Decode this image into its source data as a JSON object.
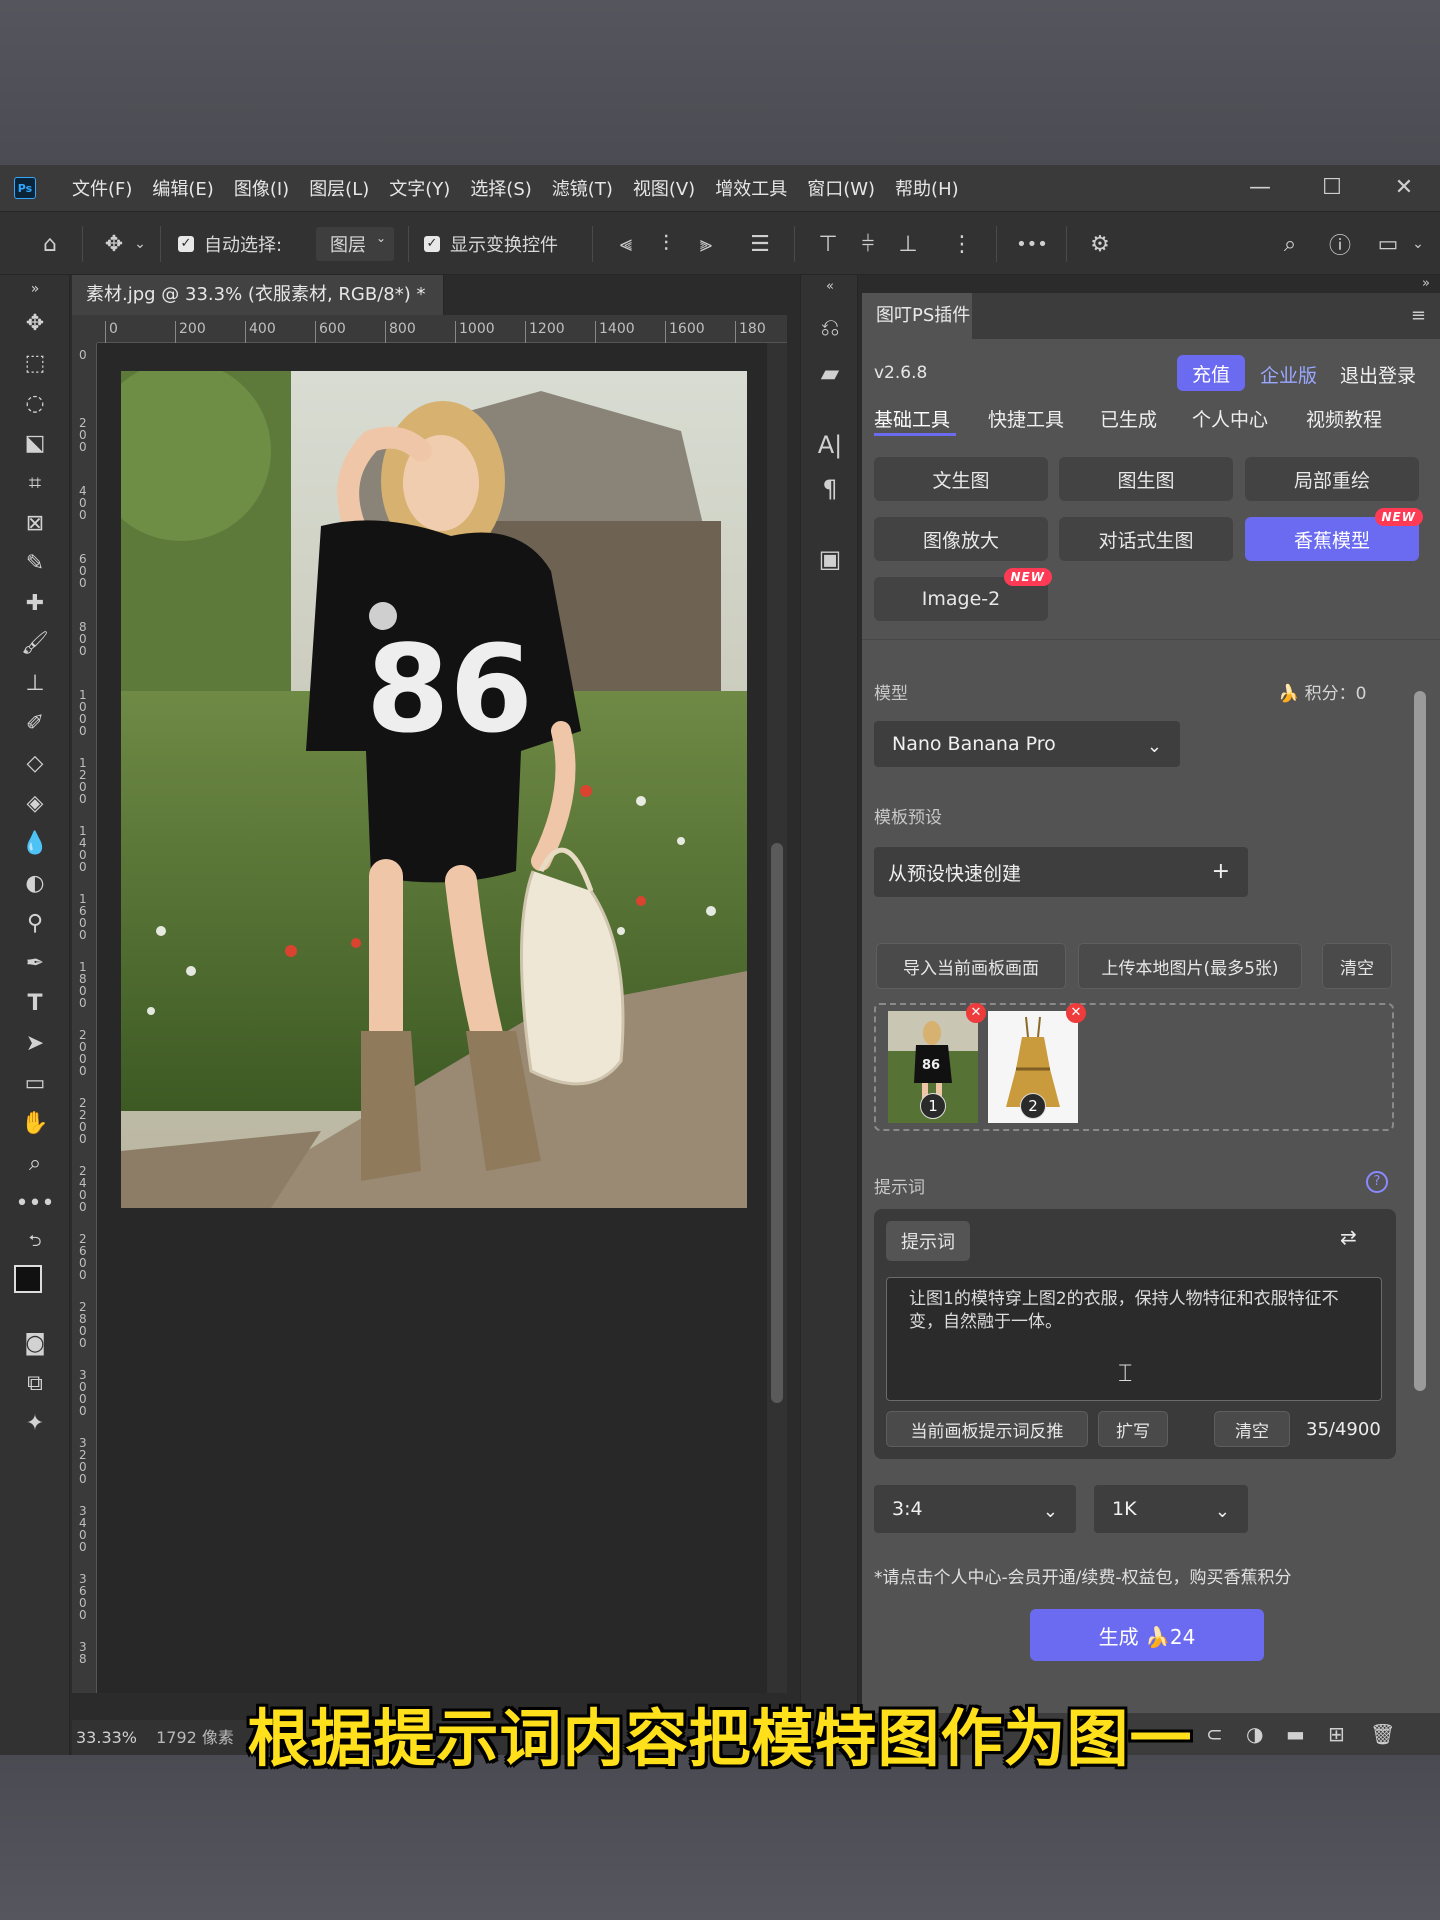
{
  "window": {
    "app_logo": "Ps",
    "menu": [
      "文件(F)",
      "编辑(E)",
      "图像(I)",
      "图层(L)",
      "文字(Y)",
      "选择(S)",
      "滤镜(T)",
      "视图(V)",
      "增效工具",
      "窗口(W)",
      "帮助(H)"
    ],
    "controls": {
      "minimize": "—",
      "maximize": "☐",
      "close": "✕"
    }
  },
  "options_bar": {
    "auto_select_label": "自动选择:",
    "auto_select_value": "图层",
    "show_transform_label": "显示变换控件",
    "more_label": "•••"
  },
  "document": {
    "tab_title": "素材.jpg @ 33.3% (衣服素材, RGB/8*) *",
    "tab_close": "×",
    "ruler_h": [
      "0",
      "200",
      "400",
      "600",
      "800",
      "1000",
      "1200",
      "1400",
      "1600",
      "180"
    ],
    "ruler_v": [
      "0",
      "2\n0\n0",
      "4\n0\n0",
      "6\n0\n0",
      "8\n0\n0",
      "1\n0\n0\n0",
      "1\n2\n0\n0",
      "1\n4\n0\n0",
      "1\n6\n0\n0",
      "1\n8\n0\n0",
      "2\n0\n0\n0",
      "2\n2\n0\n0",
      "2\n4\n0\n0",
      "2\n6\n0\n0",
      "2\n8\n0\n0",
      "3\n0\n0\n0",
      "3\n2\n0\n0",
      "3\n4\n0\n0",
      "3\n6\n0\n0",
      "3\n8"
    ],
    "zoom": "33.33%",
    "size_info": "1792 像素"
  },
  "plugin": {
    "tab_title": "图叮PS插件",
    "version": "v2.6.8",
    "recharge": "充值",
    "enterprise": "企业版",
    "logout": "退出登录",
    "nav_tabs": [
      "基础工具",
      "快捷工具",
      "已生成",
      "个人中心",
      "视频教程"
    ],
    "features": [
      {
        "label": "文生图",
        "new": false,
        "active": false
      },
      {
        "label": "图生图",
        "new": false,
        "active": false
      },
      {
        "label": "局部重绘",
        "new": false,
        "active": false
      },
      {
        "label": "图像放大",
        "new": false,
        "active": false
      },
      {
        "label": "对话式生图",
        "new": false,
        "active": false
      },
      {
        "label": "香蕉模型",
        "new": true,
        "active": true
      },
      {
        "label": "Image-2",
        "new": true,
        "active": false
      }
    ],
    "new_badge": "NEW",
    "model_label": "模型",
    "points": "积分：0",
    "model_value": "Nano Banana Pro",
    "template_label": "模板预设",
    "template_value": "从预设快速创建",
    "template_add": "+",
    "import_canvas": "导入当前画板画面",
    "upload_local": "上传本地图片(最多5张)",
    "clear_images": "清空",
    "image_numbers": [
      "1",
      "2"
    ],
    "prompt_label": "提示词",
    "prompt_tag": "提示词",
    "prompt_text": "让图1的模特穿上图2的衣服，保持人物特征和衣服特征不变，自然融于一体。",
    "reverse_prompt": "当前画板提示词反推",
    "expand": "扩写",
    "clear_prompt": "清空",
    "char_count": "35/4900",
    "ratio_value": "3:4",
    "resolution_value": "1K",
    "notice": "*请点击个人中心-会员开通/续费-权益包，购买香蕉积分",
    "generate": "生成 🍌24"
  },
  "subtitle": "根据提示词内容把模特图作为图一",
  "colors": {
    "accent": "#6b6bf2",
    "badge": "#ff3a54",
    "subtitle": "#ffe01b"
  }
}
